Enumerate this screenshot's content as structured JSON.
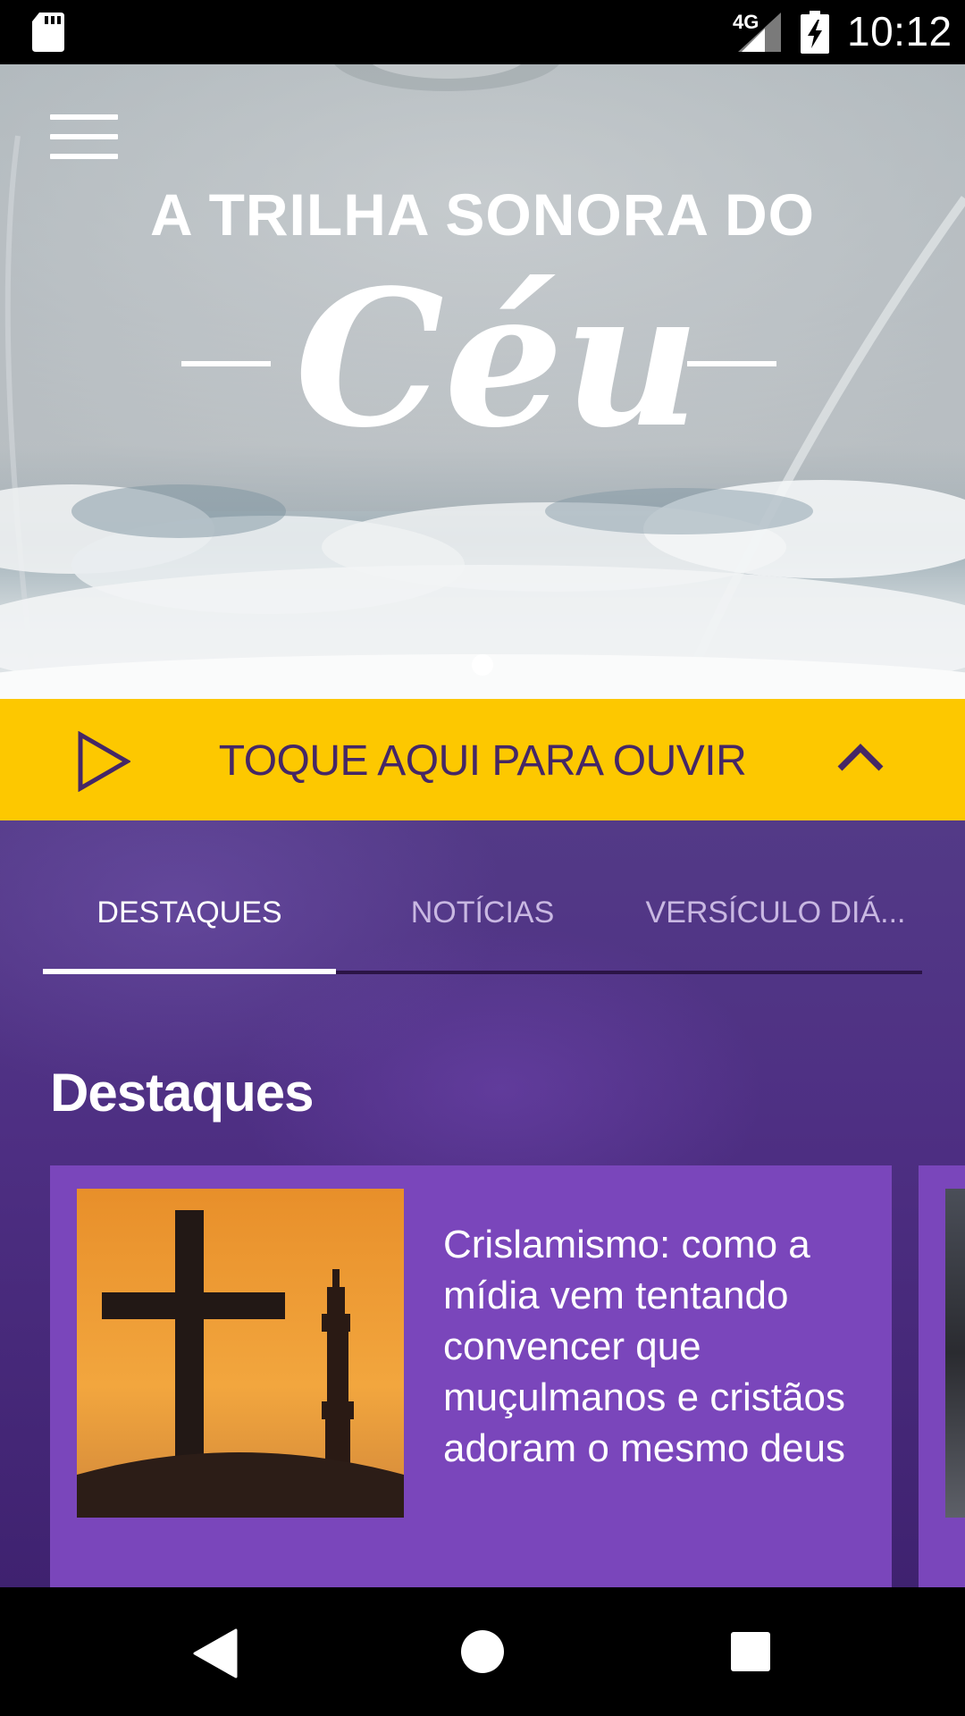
{
  "status_bar": {
    "network": "4G",
    "time": "10:12"
  },
  "hero": {
    "title": "A TRILHA SONORA DO",
    "script_word": "Céu",
    "slides": 1
  },
  "player": {
    "label": "TOQUE AQUI PARA OUVIR",
    "accent": "#fdc800",
    "text_color": "#452766"
  },
  "tabs": [
    {
      "label": "DESTAQUES",
      "active": true
    },
    {
      "label": "NOTÍCIAS",
      "active": false
    },
    {
      "label": "VERSÍCULO DIÁ...",
      "active": false
    }
  ],
  "section": {
    "title": "Destaques"
  },
  "featured": [
    {
      "title": "Crislamismo: como a mídia vem tentando convencer que muçulmanos e cristãos adoram o mesmo deus"
    }
  ],
  "colors": {
    "purple": "#4e2f83",
    "card": "#7a46bb"
  },
  "icons": [
    "sd-card-icon",
    "signal-icon",
    "battery-charging-icon",
    "menu-icon",
    "play-icon",
    "chevron-up-icon",
    "back-icon",
    "home-icon",
    "recent-apps-icon"
  ]
}
